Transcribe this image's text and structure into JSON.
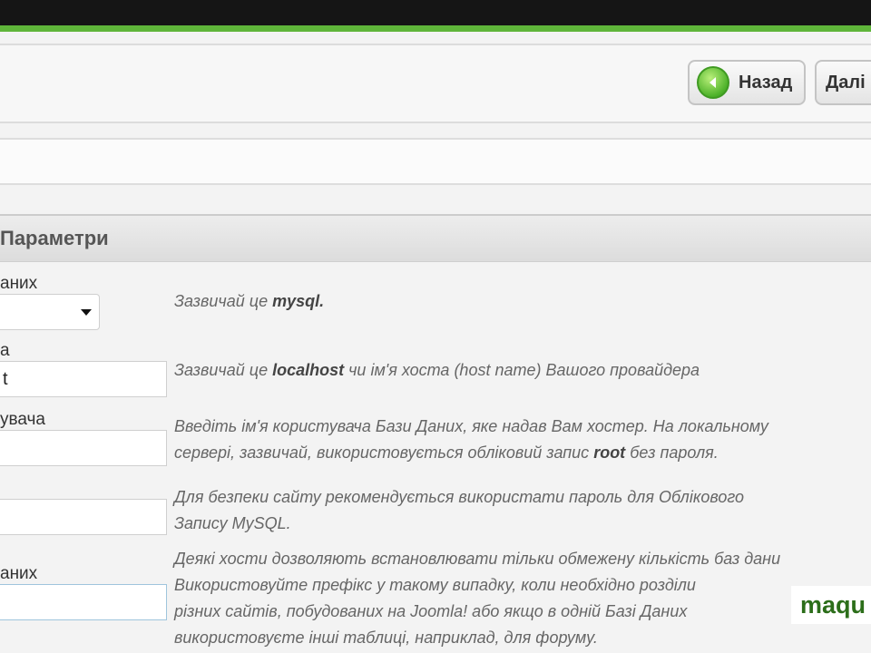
{
  "toolbar": {
    "back_label": "Назад",
    "next_label": "Далі"
  },
  "section": {
    "title": "Параметри"
  },
  "fields": [
    {
      "label": "аних",
      "value": "",
      "hint_pre": "Зазвичай це ",
      "hint_bold": "mysql.",
      "hint_post": ""
    },
    {
      "label": "а",
      "value": "t",
      "hint_pre": "Зазвичай це ",
      "hint_bold": "localhost",
      "hint_post": " чи ім'я хоста (host name) Вашого провайдера"
    },
    {
      "label": "увача",
      "value": "",
      "hint_line1": "Введіть ім'я користувача Бази Даних, яке надав Вам хостер. На локальному",
      "hint_line2_pre": "сервері, зазвичай, використовується обліковий запис ",
      "hint_line2_bold": "root",
      "hint_line2_post": " без пароля."
    },
    {
      "label": "",
      "value": "",
      "hint_line1": "Для безпеки сайту рекомендується використати пароль для Облікового",
      "hint_line2": "Запису MySQL."
    },
    {
      "label": "аних",
      "value": "",
      "hint_lines": [
        "Деякі хости дозволяють встановлювати тільки обмежену кількість баз дани",
        "Використовуйте префікс у такому випадку, коли необхідно розділи",
        "різних сайтів, побудованих на Joomla! або якщо в одній Базі Даних",
        "використовуєте інші таблиці, наприклад, для форуму."
      ]
    }
  ],
  "logo": {
    "text": "maqu"
  },
  "colors": {
    "accent_green": "#5fb53a",
    "top_bar": "#151515"
  },
  "icons": {
    "back": "green-circle-arrow-left-icon",
    "select": "dropdown-caret-icon"
  }
}
